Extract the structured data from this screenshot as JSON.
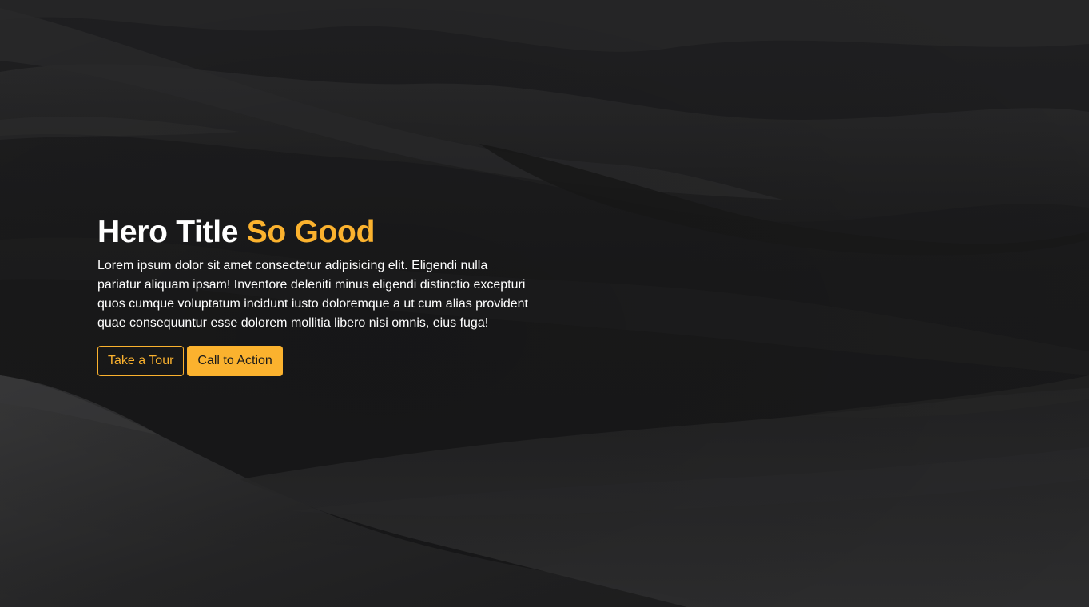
{
  "hero": {
    "title_main": "Hero Title",
    "title_accent": "So Good",
    "text": "Lorem ipsum dolor sit amet consectetur adipisicing elit. Eligendi nulla pariatur aliquam ipsam! Inventore deleniti minus eligendi distinctio excepturi quos cumque voluptatum incidunt iusto doloremque a ut cum alias provident quae consequuntur esse dolorem mollitia libero nisi omnis, eius fuga!",
    "background": "dark sand dunes photo"
  },
  "actions": {
    "tour_label": "Take a Tour",
    "cta_label": "Call to Action"
  },
  "colors": {
    "accent": "#fbb22e",
    "background": "#1b1b1c",
    "text": "#ffffff"
  }
}
